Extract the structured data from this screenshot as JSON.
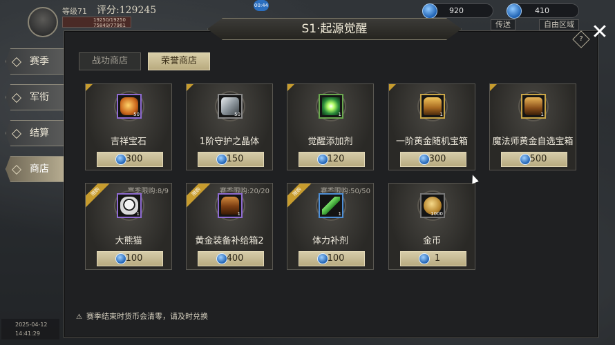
{
  "hud": {
    "level": "等级71",
    "score": "评分:129245",
    "hp": "19250/19250",
    "exp": "75849/77961",
    "clock": "00:44",
    "currency_a": "920",
    "currency_b": "410",
    "tab_send": "传送",
    "tab_free": "自由区域"
  },
  "nav": {
    "items": [
      {
        "label": "赛季"
      },
      {
        "label": "军衔"
      },
      {
        "label": "结算"
      },
      {
        "label": "商店"
      }
    ]
  },
  "window": {
    "title": "S1·起源觉醒",
    "help": "?",
    "close": "✕"
  },
  "tabs": [
    {
      "label": "战功商店"
    },
    {
      "label": "荣誉商店"
    }
  ],
  "items": [
    {
      "name": "吉祥宝石",
      "price": "300",
      "qty": "50",
      "limit": "",
      "ribbon": ""
    },
    {
      "name": "1阶守护之晶体",
      "price": "150",
      "qty": "50",
      "limit": "",
      "ribbon": ""
    },
    {
      "name": "觉醒添加剂",
      "price": "120",
      "qty": "1",
      "limit": "",
      "ribbon": ""
    },
    {
      "name": "一阶黄金随机宝箱",
      "price": "300",
      "qty": "1",
      "limit": "",
      "ribbon": ""
    },
    {
      "name": "魔法师黄金自选宝箱",
      "price": "500",
      "qty": "1",
      "limit": "",
      "ribbon": ""
    },
    {
      "name": "大熊猫",
      "price": "100",
      "qty": "1",
      "limit": "赛季限购:8/9",
      "ribbon": "限购"
    },
    {
      "name": "黄金装备补给箱2",
      "price": "400",
      "qty": "1",
      "limit": "赛季限购:20/20",
      "ribbon": "限购"
    },
    {
      "name": "体力补剂",
      "price": "100",
      "qty": "1",
      "limit": "赛季限购:50/50",
      "ribbon": "限购"
    },
    {
      "name": "金币",
      "price": "1",
      "qty": "1000",
      "limit": "",
      "ribbon": ""
    }
  ],
  "footer": {
    "warning_icon": "⚠",
    "note": "赛季结束时货币会清零，请及时兑换"
  },
  "corner": {
    "date": "2025-04-12",
    "time": "14:41:29"
  }
}
